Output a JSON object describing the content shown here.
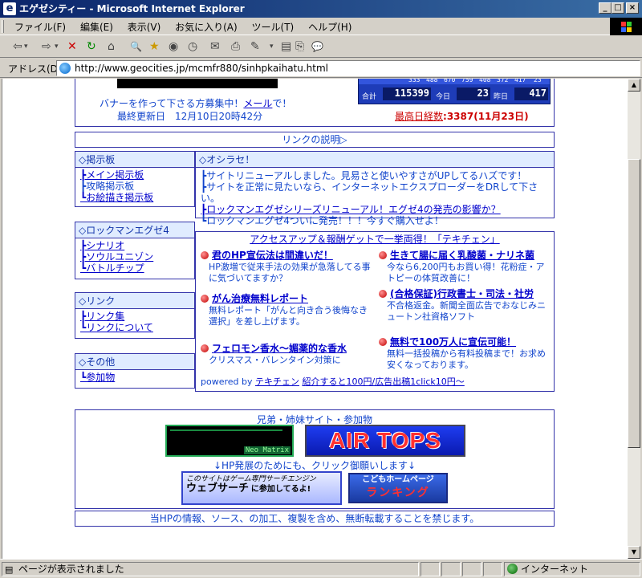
{
  "window": {
    "title": "エゲゼシティー - Microsoft Internet Explorer",
    "min_label": "_",
    "max_label": "□",
    "close_label": "×"
  },
  "menu": {
    "items": [
      "ファイル(F)",
      "編集(E)",
      "表示(V)",
      "お気に入り(A)",
      "ツール(T)",
      "ヘルプ(H)"
    ]
  },
  "toolbar": {
    "back": "⇦",
    "forward": "⇨",
    "stop": "✕",
    "refresh": "↻",
    "home": "⌂",
    "search": "🔍",
    "favorites": "★",
    "history": "◷",
    "mail": "✉",
    "print": "⎙",
    "edit": "✎",
    "discuss": "💬"
  },
  "address": {
    "label": "アドレス(D)",
    "url": "http://www.geocities.jp/mcmfr880/sinhpkaihatu.html"
  },
  "header": {
    "banner_recruit": "バナーを作って下さる方募集中！",
    "mail_link": "メール",
    "banner_recruit_suffix": "で！",
    "last_updated": "最終更新日　12月10日20時42分",
    "counter_row": [
      "333",
      "488",
      "670",
      "759",
      "408",
      "372",
      "417",
      "23"
    ],
    "total_label": "合計",
    "total_value": "115399",
    "today_label": "今日",
    "today_value": "23",
    "yesterday_label": "昨日",
    "yesterday_value": "417",
    "max_label": "最高日経数",
    "max_value": ":3387(11月23日)"
  },
  "link_desc": "リンクの説明▷",
  "bbs": {
    "title": "◇掲示板",
    "items": [
      "┣メイン掲示板",
      "┣攻略掲示板",
      "┗お絵描き掲示板"
    ]
  },
  "news": {
    "title": "◇オシラセ！",
    "items": [
      "┣サイトリニューアルしました。見易さと使いやすさがUPしてるハズです！",
      "┣サイトを正常に見たいなら、インターネットエクスプローダーをDRして下さい。",
      "┣ロックマンエグゼシリーズリニューアル！エグゼ4の発売の影響か？",
      "┗ロックマンエグゼ4ついに発売！！！今すぐ購入せよ！"
    ]
  },
  "exe4": {
    "title": "◇ロックマンエグゼ4",
    "items": [
      "┣シナリオ",
      "┣ソウルユニゾン",
      "┗バトルチップ"
    ]
  },
  "links": {
    "title": "◇リンク",
    "items": [
      "┣リンク集",
      "┗リンクについて"
    ]
  },
  "other": {
    "title": "◇その他",
    "items": [
      "┗参加物"
    ]
  },
  "ads": {
    "header": "アクセスアップ＆報酬ゲットで一挙両得！「テキチェン」",
    "items": [
      {
        "title": "君のHP宣伝法は間違いだ！",
        "desc": "HP激増で従来手法の効果が急落してる事に気づいてますか？"
      },
      {
        "title": "生きて腸に届く乳酸菌・ナリネ菌",
        "desc": "今なら6,200円もお買い得！花粉症・アトピーの体質改善に！"
      },
      {
        "title": "がん治療無料レポート",
        "desc": "無料レポート「がんと向き合う後悔なき選択」を差し上げます。"
      },
      {
        "title": "(合格保証)行政書士・司法・社労",
        "desc": "不合格返金。新聞全面広告でおなじみニュートン社資格ソフト"
      },
      {
        "title": "フェロモン香水～媚薬的な香水",
        "desc": "クリスマス・バレンタイン対策に"
      },
      {
        "title": "無料で100万人に宣伝可能！",
        "desc": "無料一括投稿から有料投稿まで！お求め安くなっております。"
      }
    ],
    "powered": "powered by",
    "powered_link": "テキチェン",
    "powered_suffix": "紹介すると100円/広告出稿1click10円～"
  },
  "sister": {
    "title": "兄弟・姉妹サイト・参加物",
    "neo_matrix": "Neo Matrix",
    "air_tops": "AIR TOPS",
    "click_msg": "↓HP発展のためにも、クリック御願いします↓",
    "websearch_line1": "このサイトはゲーム専門サーチエンジン",
    "websearch_line2": "ウェブサーチ",
    "websearch_line3": "に参加してるよ!",
    "kids_line1": "こどもホームページ",
    "kids_line2": "ランキング"
  },
  "copyright": "当HPの情報、ソース、の加工、複製を含め、無断転載することを禁じます。",
  "status": {
    "left": "ページが表示されました",
    "zone": "インターネット"
  },
  "colors": {
    "accent": "#1144cc",
    "border": "#3333aa",
    "max_red": "#cc0000"
  }
}
